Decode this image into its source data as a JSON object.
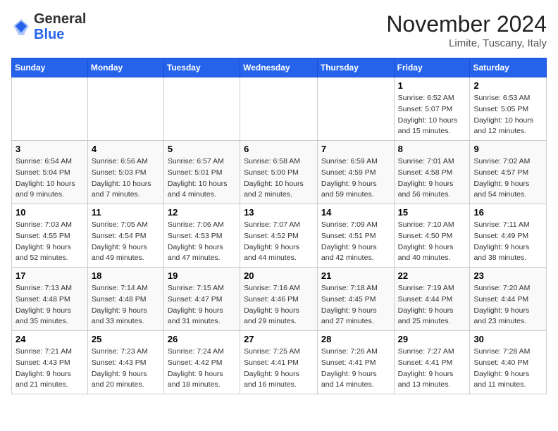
{
  "header": {
    "logo_general": "General",
    "logo_blue": "Blue",
    "month_title": "November 2024",
    "location": "Limite, Tuscany, Italy"
  },
  "weekdays": [
    "Sunday",
    "Monday",
    "Tuesday",
    "Wednesday",
    "Thursday",
    "Friday",
    "Saturday"
  ],
  "weeks": [
    [
      {
        "day": "",
        "info": ""
      },
      {
        "day": "",
        "info": ""
      },
      {
        "day": "",
        "info": ""
      },
      {
        "day": "",
        "info": ""
      },
      {
        "day": "",
        "info": ""
      },
      {
        "day": "1",
        "info": "Sunrise: 6:52 AM\nSunset: 5:07 PM\nDaylight: 10 hours and 15 minutes."
      },
      {
        "day": "2",
        "info": "Sunrise: 6:53 AM\nSunset: 5:05 PM\nDaylight: 10 hours and 12 minutes."
      }
    ],
    [
      {
        "day": "3",
        "info": "Sunrise: 6:54 AM\nSunset: 5:04 PM\nDaylight: 10 hours and 9 minutes."
      },
      {
        "day": "4",
        "info": "Sunrise: 6:56 AM\nSunset: 5:03 PM\nDaylight: 10 hours and 7 minutes."
      },
      {
        "day": "5",
        "info": "Sunrise: 6:57 AM\nSunset: 5:01 PM\nDaylight: 10 hours and 4 minutes."
      },
      {
        "day": "6",
        "info": "Sunrise: 6:58 AM\nSunset: 5:00 PM\nDaylight: 10 hours and 2 minutes."
      },
      {
        "day": "7",
        "info": "Sunrise: 6:59 AM\nSunset: 4:59 PM\nDaylight: 9 hours and 59 minutes."
      },
      {
        "day": "8",
        "info": "Sunrise: 7:01 AM\nSunset: 4:58 PM\nDaylight: 9 hours and 56 minutes."
      },
      {
        "day": "9",
        "info": "Sunrise: 7:02 AM\nSunset: 4:57 PM\nDaylight: 9 hours and 54 minutes."
      }
    ],
    [
      {
        "day": "10",
        "info": "Sunrise: 7:03 AM\nSunset: 4:55 PM\nDaylight: 9 hours and 52 minutes."
      },
      {
        "day": "11",
        "info": "Sunrise: 7:05 AM\nSunset: 4:54 PM\nDaylight: 9 hours and 49 minutes."
      },
      {
        "day": "12",
        "info": "Sunrise: 7:06 AM\nSunset: 4:53 PM\nDaylight: 9 hours and 47 minutes."
      },
      {
        "day": "13",
        "info": "Sunrise: 7:07 AM\nSunset: 4:52 PM\nDaylight: 9 hours and 44 minutes."
      },
      {
        "day": "14",
        "info": "Sunrise: 7:09 AM\nSunset: 4:51 PM\nDaylight: 9 hours and 42 minutes."
      },
      {
        "day": "15",
        "info": "Sunrise: 7:10 AM\nSunset: 4:50 PM\nDaylight: 9 hours and 40 minutes."
      },
      {
        "day": "16",
        "info": "Sunrise: 7:11 AM\nSunset: 4:49 PM\nDaylight: 9 hours and 38 minutes."
      }
    ],
    [
      {
        "day": "17",
        "info": "Sunrise: 7:13 AM\nSunset: 4:48 PM\nDaylight: 9 hours and 35 minutes."
      },
      {
        "day": "18",
        "info": "Sunrise: 7:14 AM\nSunset: 4:48 PM\nDaylight: 9 hours and 33 minutes."
      },
      {
        "day": "19",
        "info": "Sunrise: 7:15 AM\nSunset: 4:47 PM\nDaylight: 9 hours and 31 minutes."
      },
      {
        "day": "20",
        "info": "Sunrise: 7:16 AM\nSunset: 4:46 PM\nDaylight: 9 hours and 29 minutes."
      },
      {
        "day": "21",
        "info": "Sunrise: 7:18 AM\nSunset: 4:45 PM\nDaylight: 9 hours and 27 minutes."
      },
      {
        "day": "22",
        "info": "Sunrise: 7:19 AM\nSunset: 4:44 PM\nDaylight: 9 hours and 25 minutes."
      },
      {
        "day": "23",
        "info": "Sunrise: 7:20 AM\nSunset: 4:44 PM\nDaylight: 9 hours and 23 minutes."
      }
    ],
    [
      {
        "day": "24",
        "info": "Sunrise: 7:21 AM\nSunset: 4:43 PM\nDaylight: 9 hours and 21 minutes."
      },
      {
        "day": "25",
        "info": "Sunrise: 7:23 AM\nSunset: 4:43 PM\nDaylight: 9 hours and 20 minutes."
      },
      {
        "day": "26",
        "info": "Sunrise: 7:24 AM\nSunset: 4:42 PM\nDaylight: 9 hours and 18 minutes."
      },
      {
        "day": "27",
        "info": "Sunrise: 7:25 AM\nSunset: 4:41 PM\nDaylight: 9 hours and 16 minutes."
      },
      {
        "day": "28",
        "info": "Sunrise: 7:26 AM\nSunset: 4:41 PM\nDaylight: 9 hours and 14 minutes."
      },
      {
        "day": "29",
        "info": "Sunrise: 7:27 AM\nSunset: 4:41 PM\nDaylight: 9 hours and 13 minutes."
      },
      {
        "day": "30",
        "info": "Sunrise: 7:28 AM\nSunset: 4:40 PM\nDaylight: 9 hours and 11 minutes."
      }
    ]
  ]
}
